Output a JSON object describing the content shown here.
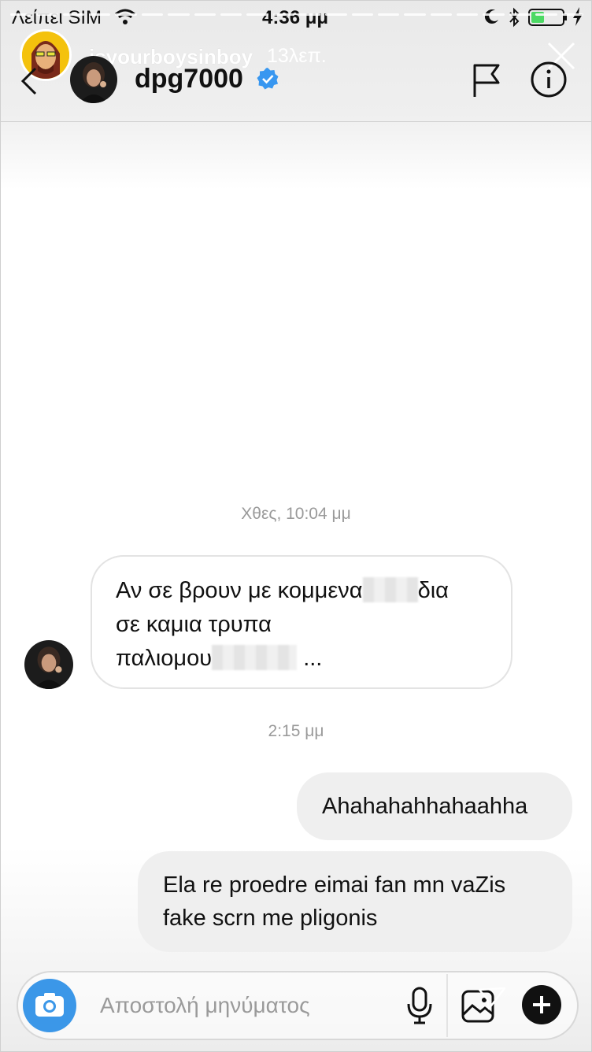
{
  "status_bar": {
    "carrier": "Λείπει SIM",
    "time": "4:36 μμ"
  },
  "story": {
    "username": "isyourboysinboy",
    "time_ago": "13λεπ."
  },
  "chat": {
    "name": "dpg7000",
    "verified": true
  },
  "messages": {
    "timestamp_1": "Χθες, 10:04 μμ",
    "incoming_1": {
      "line1_prefix": "Αν σε βρουν με κομμενα",
      "line1_suffix": "δια",
      "line2": "σε καμια τρυπα",
      "line3_prefix": "παλιομου",
      "line3_suffix": " ..."
    },
    "timestamp_2": "2:15 μμ",
    "outgoing_1": "Ahahahahhahaahha",
    "outgoing_2": "Ela re proedre eimai fan mn vaZis fake scrn me pligonis"
  },
  "composer": {
    "placeholder": "Αποστολή μηνύματος"
  },
  "colors": {
    "accent_blue": "#3b97e8",
    "verified_blue": "#3897f0",
    "outgoing_bubble": "#efefef"
  },
  "icons": [
    "wifi-icon",
    "moon-icon",
    "bluetooth-icon",
    "battery-icon",
    "close-icon",
    "back-icon",
    "verified-icon",
    "flag-icon",
    "info-icon",
    "camera-icon",
    "mic-icon",
    "gallery-icon",
    "send-icon",
    "plus-icon"
  ]
}
